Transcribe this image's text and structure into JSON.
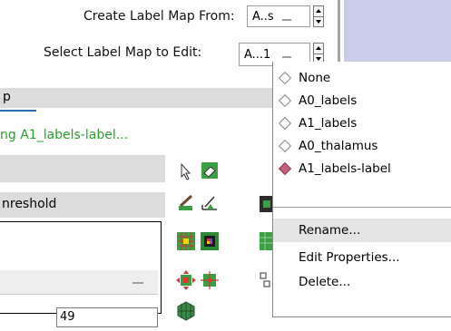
{
  "header": {
    "create_label": "Create Label Map From:",
    "create_value": "A..s",
    "select_label": "Select Label Map to Edit:",
    "select_value": "A...1"
  },
  "panel": {
    "section_fragment": "p",
    "status_fragment": "ng A1_labels-label...",
    "threshold_fragment": "nreshold",
    "value_field": "49"
  },
  "menu": {
    "options": [
      "None",
      "A0_labels",
      "A1_labels",
      "A0_thalamus",
      "A1_labels-label"
    ],
    "selected_index": 4,
    "actions": [
      "Rename...",
      "Edit Properties...",
      "Delete..."
    ],
    "highlighted_action": "Rename..."
  },
  "colors": {
    "accent_bar": "#2b6fb0",
    "status_text": "#2aa02a",
    "right_panel": "#c9cce9",
    "menu_highlight": "#e4e4e4"
  },
  "icons": [
    "arrow-cursor-icon",
    "eraser-icon",
    "draw-pencil-icon",
    "level-tracing-icon",
    "change-island-icon",
    "paint-grid-icon",
    "identify-island-icon",
    "threshold-grid-icon",
    "dilate-icon",
    "erode-icon",
    "save-island-icon",
    "wand-effect-icon"
  ]
}
